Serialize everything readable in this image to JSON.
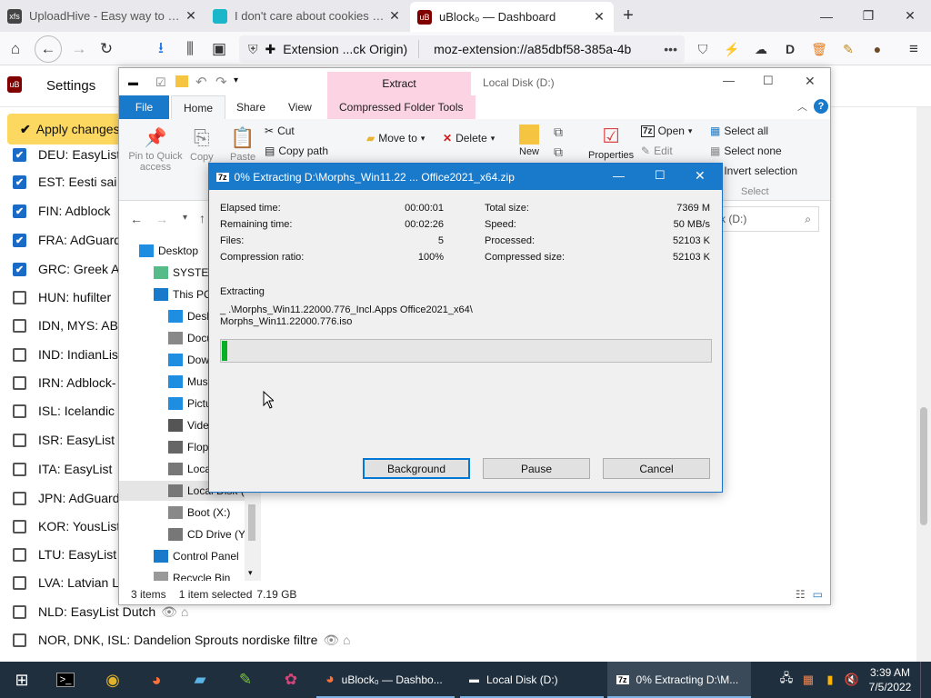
{
  "browser": {
    "tabs": [
      {
        "label": "UploadHive - Easy way to share",
        "favicon": "xfs"
      },
      {
        "label": "I don't care about cookies – Get",
        "favicon": "ext"
      },
      {
        "label": "uBlock₀ — Dashboard",
        "favicon": "uB"
      }
    ],
    "url_identity": "Extension ...ck Origin)",
    "url": "moz-extension://a85dbf58-385a-4b",
    "url_more": "•••"
  },
  "ublock": {
    "settings_tab": "Settings",
    "apply_button": "Apply changes",
    "filters": [
      {
        "label": "DEU: EasyList",
        "checked": true
      },
      {
        "label": "EST: Eesti sai",
        "checked": true
      },
      {
        "label": "FIN: Adblock",
        "checked": true
      },
      {
        "label": "FRA: AdGuard",
        "checked": true
      },
      {
        "label": "GRC: Greek A",
        "checked": true
      },
      {
        "label": "HUN: hufilter",
        "checked": false
      },
      {
        "label": "IDN, MYS: AB",
        "checked": false
      },
      {
        "label": "IND: IndianLis",
        "checked": false
      },
      {
        "label": "IRN: Adblock-",
        "checked": false
      },
      {
        "label": "ISL: Icelandic",
        "checked": false
      },
      {
        "label": "ISR: EasyList",
        "checked": false
      },
      {
        "label": "ITA: EasyList",
        "checked": false
      },
      {
        "label": "JPN: AdGuard",
        "checked": false
      },
      {
        "label": "KOR: YousList",
        "checked": false
      },
      {
        "label": "LTU: EasyList",
        "checked": false
      },
      {
        "label": "LVA: Latvian L",
        "checked": false
      },
      {
        "label": "NLD: EasyList Dutch",
        "checked": false
      },
      {
        "label": "NOR, DNK, ISL: Dandelion Sprouts nordiske filtre",
        "checked": false
      }
    ]
  },
  "explorer": {
    "title": "Local Disk (D:)",
    "context_tab": "Extract",
    "ribbon_tabs": [
      "File",
      "Home",
      "Share",
      "View",
      "Compressed Folder Tools"
    ],
    "clipboard": {
      "pin": "Pin to Quick access",
      "copy": "Copy",
      "paste": "Paste",
      "cut": "Cut",
      "copy_path": "Copy path"
    },
    "organize": {
      "move_to": "Move to",
      "delete": "Delete"
    },
    "new_label": "New",
    "open": {
      "properties": "Properties",
      "open": "Open",
      "edit": "Edit"
    },
    "select": {
      "all": "Select all",
      "none": "Select none",
      "invert": "Invert selection",
      "group": "Select"
    },
    "search_placeholder": "k (D:)",
    "nav_items": [
      {
        "label": "Desktop",
        "indent": 0
      },
      {
        "label": "SYSTEM",
        "indent": 1
      },
      {
        "label": "This PC",
        "indent": 1
      },
      {
        "label": "Desktop",
        "indent": 2
      },
      {
        "label": "Docum",
        "indent": 2
      },
      {
        "label": "Downlo",
        "indent": 2
      },
      {
        "label": "Music",
        "indent": 2
      },
      {
        "label": "Picture",
        "indent": 2
      },
      {
        "label": "Videos",
        "indent": 2
      },
      {
        "label": "Floppy",
        "indent": 2
      },
      {
        "label": "Local D",
        "indent": 2
      },
      {
        "label": "Local Disk (D:)",
        "indent": 2
      },
      {
        "label": "Boot (X:)",
        "indent": 2
      },
      {
        "label": "CD Drive (Y:) H",
        "indent": 2
      },
      {
        "label": "Control Panel",
        "indent": 1
      },
      {
        "label": "Recycle Bin",
        "indent": 1
      }
    ],
    "status": {
      "items": "3 items",
      "selected": "1 item selected",
      "size": "7.19 GB"
    }
  },
  "zip": {
    "title": "0% Extracting D:\\Morphs_Win11.22 ... Office2021_x64.zip",
    "left": [
      {
        "label": "Elapsed time:",
        "value": "00:00:01"
      },
      {
        "label": "Remaining time:",
        "value": "00:02:26"
      },
      {
        "label": "Files:",
        "value": "5"
      },
      {
        "label": "Compression ratio:",
        "value": "100%"
      }
    ],
    "right": [
      {
        "label": "Total size:",
        "value": "7369 M"
      },
      {
        "label": "Speed:",
        "value": "50 MB/s"
      },
      {
        "label": "Processed:",
        "value": "52103 K"
      },
      {
        "label": "Compressed size:",
        "value": "52103 K"
      }
    ],
    "operation": "Extracting",
    "path_line1": "_ .\\Morphs_Win11.22000.776_Incl.Apps Office2021_x64\\",
    "path_line2": "Morphs_Win11.22000.776.iso",
    "progress": 0.01,
    "buttons": {
      "background": "Background",
      "pause": "Pause",
      "cancel": "Cancel"
    }
  },
  "taskbar": {
    "windows": [
      {
        "label": "uBlock₀ — Dashbo...",
        "icon": "firefox-icon"
      },
      {
        "label": "Local Disk (D:)",
        "icon": "drive-icon"
      },
      {
        "label": "0% Extracting D:\\M...",
        "icon": "7zip-icon"
      }
    ],
    "time": "3:39 AM",
    "date": "7/5/2022"
  },
  "colors": {
    "accent": "#1979ca",
    "progress": "#06b025",
    "apply": "#fcd860",
    "taskbar": "#1f2f3d"
  }
}
